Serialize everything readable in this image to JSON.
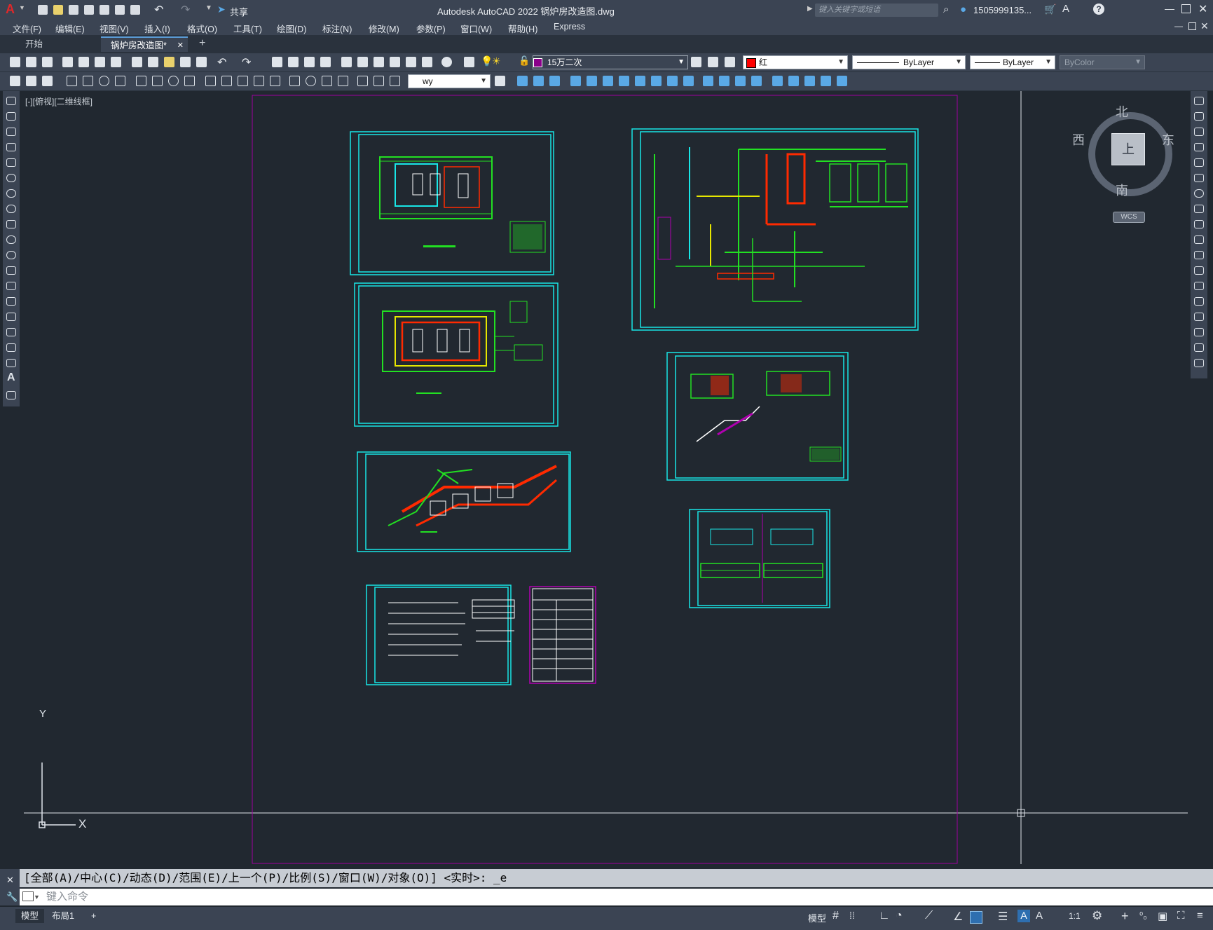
{
  "titlebar": {
    "app_logo": "A",
    "share_label": "共享",
    "title": "Autodesk AutoCAD 2022    锅炉房改造图.dwg",
    "search_placeholder": "键入关键字或短语",
    "user_label": "1505999135...",
    "help_label": "?"
  },
  "menu": [
    "文件(F)",
    "编辑(E)",
    "视图(V)",
    "插入(I)",
    "格式(O)",
    "工具(T)",
    "绘图(D)",
    "标注(N)",
    "修改(M)",
    "参数(P)",
    "窗口(W)",
    "帮助(H)",
    "Express"
  ],
  "tabs": {
    "start": "开始",
    "active": "锅炉房改造图*",
    "close": "✕",
    "add": "+"
  },
  "properties": {
    "layer": "15万二次",
    "color": "红",
    "linetype": "ByLayer",
    "lineweight": "ByLayer",
    "plotstyle": "ByColor",
    "dimstyle": "wy"
  },
  "viewport": {
    "label": "[-][俯视][二维线框]"
  },
  "viewcube": {
    "north": "北",
    "south": "南",
    "east": "东",
    "west": "西",
    "face": "上",
    "wcs": "WCS"
  },
  "ucs": {
    "y": "Y",
    "x": "X"
  },
  "command": {
    "history": "[全部(A)/中心(C)/动态(D)/范围(E)/上一个(P)/比例(S)/窗口(W)/对象(O)] <实时>: _e",
    "placeholder": "键入命令"
  },
  "status": {
    "model_tab": "模型",
    "layout_tab": "布局1",
    "add": "+",
    "model_btn": "模型",
    "scale": "1:1"
  },
  "colors": {
    "background": "#212830",
    "cyan": "#19e6e6",
    "green": "#22e022",
    "red": "#ff2a00",
    "magenta": "#b000b0",
    "yellow": "#e6e600",
    "white": "#ffffff"
  }
}
